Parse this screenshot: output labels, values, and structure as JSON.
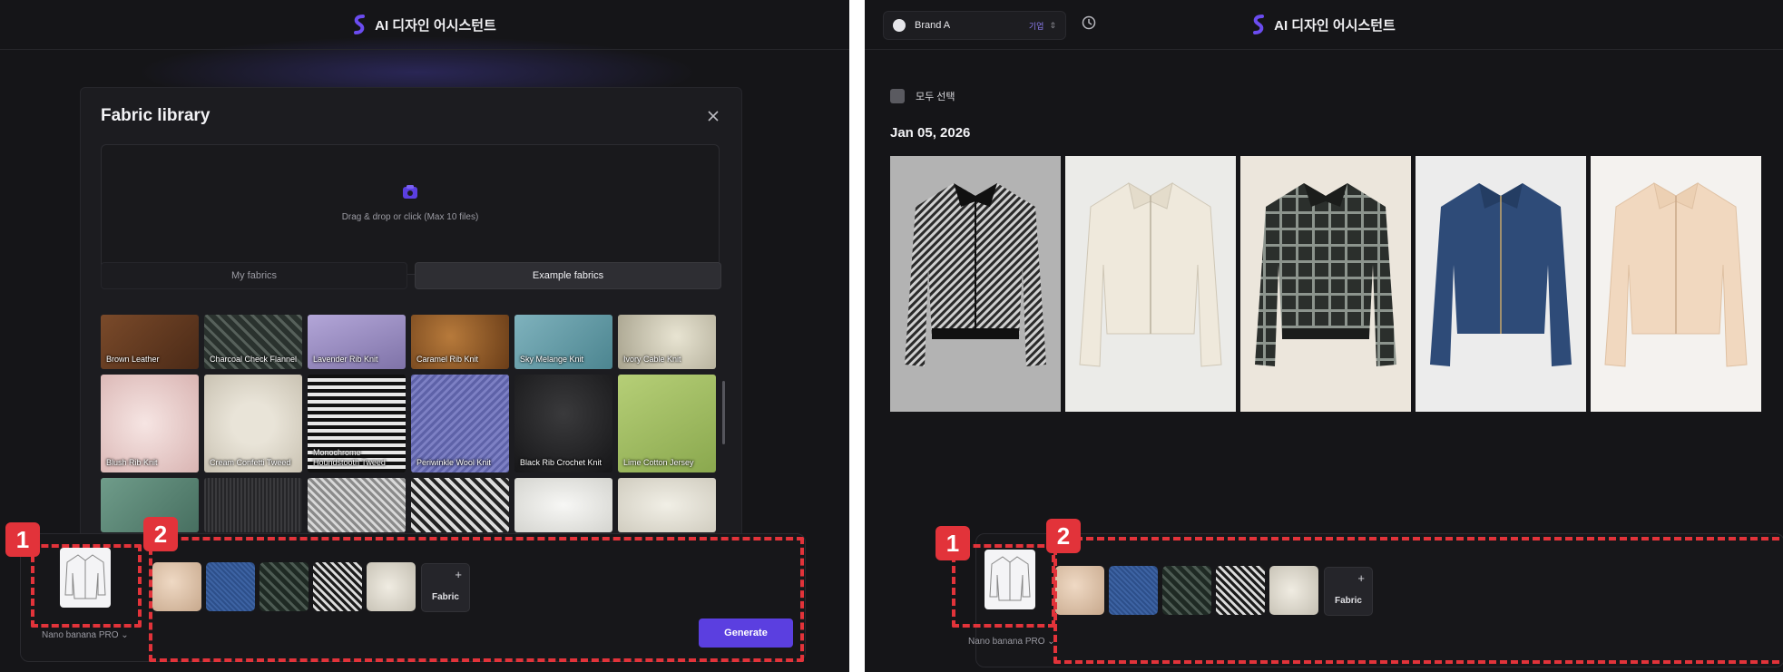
{
  "app_title": "AI 디자인 어시스턴트",
  "colors": {
    "accent": "#5b3fe0",
    "background": "#151518",
    "highlight": "#e2333a"
  },
  "left": {
    "modal": {
      "title": "Fabric library",
      "upload_text": "Drag & drop or click (Max 10 files)",
      "tabs": [
        {
          "label": "My fabrics",
          "active": false
        },
        {
          "label": "Example fabrics",
          "active": true
        }
      ],
      "fabrics": [
        {
          "name": "Brown Leather"
        },
        {
          "name": "Charcoal Check Flannel"
        },
        {
          "name": "Lavender Rib Knit"
        },
        {
          "name": "Caramel Rib Knit"
        },
        {
          "name": "Sky Melange Knit"
        },
        {
          "name": "Ivory Cable Knit"
        },
        {
          "name": "Blush Rib Knit"
        },
        {
          "name": "Cream Confetti Tweed"
        },
        {
          "name": "Monochrome Houndstooth Tweed"
        },
        {
          "name": "Periwinkle Wool Knit"
        },
        {
          "name": "Black Rib Crochet Knit"
        },
        {
          "name": "Lime Cotton Jersey"
        }
      ]
    },
    "bottom": {
      "model": "Nano banana PRO",
      "add_fabric_label": "Fabric",
      "generate_label": "Generate"
    }
  },
  "right": {
    "brand": {
      "name": "Brand A",
      "tag": "기업"
    },
    "select_all": "모두 선택",
    "date": "Jan 05, 2026",
    "bottom": {
      "model": "Nano banana PRO",
      "add_fabric_label": "Fabric"
    }
  },
  "badges": [
    "1",
    "2"
  ]
}
